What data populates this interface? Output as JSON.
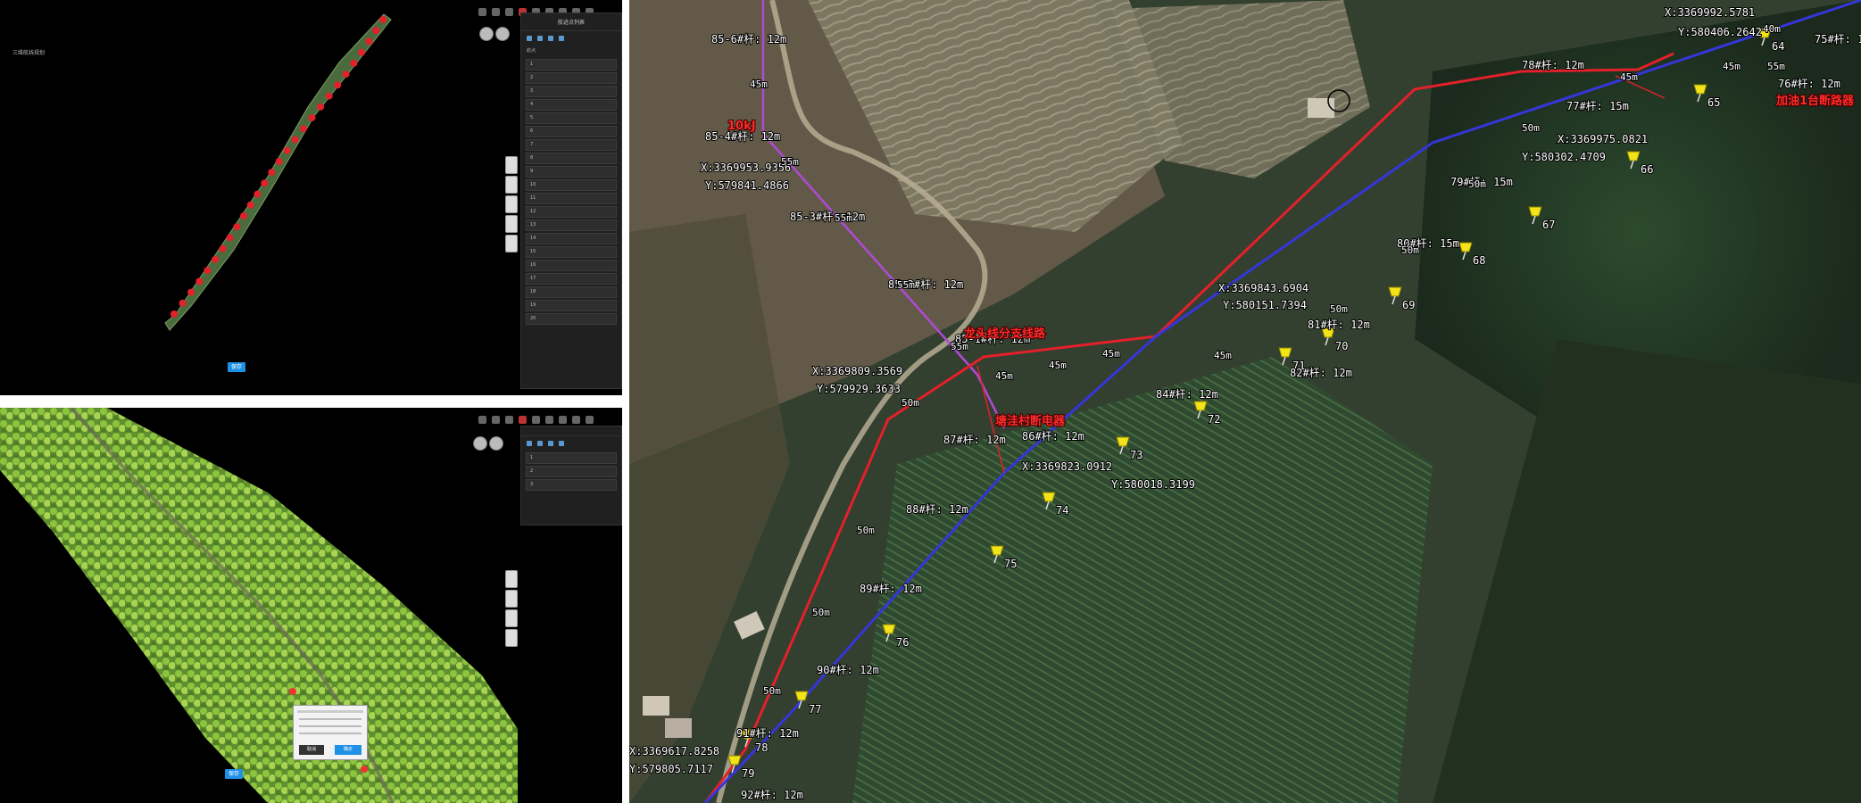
{
  "top_panel": {
    "corner_label": "三维航线规划",
    "toolbar": [
      "",
      ""
    ],
    "sidebar_title": "航迹点列表",
    "sidebar_sub_left": "航点",
    "sidebar_sub_right": "",
    "waypoints": [
      "1",
      "2",
      "3",
      "4",
      "5",
      "6",
      "7",
      "8",
      "9",
      "10",
      "11",
      "12",
      "13",
      "14",
      "15",
      "16",
      "17",
      "18",
      "19",
      "20"
    ],
    "btn_save": "保存",
    "tab_mid": "",
    "tab_right": "",
    "btn_export": ""
  },
  "bottom_panel": {
    "corner_label": "",
    "sidebar_title": "",
    "waypoints": [
      "1",
      "2",
      "3"
    ],
    "popup_btn_cancel": "取消",
    "popup_btn_ok": "确定",
    "btn_save": "保存",
    "btn_confirm": ""
  },
  "map": {
    "pole_labels": [
      "85-6#杆: 12m",
      "85-4#杆: 12m",
      "85-3#杆: 12m",
      "85-2#杆: 12m",
      "85-1#杆: 12m",
      "87#杆: 12m",
      "86#杆: 12m",
      "84#杆: 12m",
      "88#杆: 12m",
      "89#杆: 12m",
      "90#杆: 12m",
      "91#杆: 12m",
      "92#杆: 12m",
      "82#杆: 12m",
      "81#杆: 12m",
      "80#杆: 15m",
      "79#杆: 15m",
      "78#杆: 12m",
      "77#杆: 15m",
      "76#杆: 12m",
      "75#杆: 1"
    ],
    "coords": [
      "X:3369953.9356",
      "Y:579841.4866",
      "X:3369809.3569",
      "Y:579929.3633",
      "X:3369823.0912",
      "Y:580018.3199",
      "X:3369843.6904",
      "Y:580151.7394",
      "X:3369975.0821",
      "Y:580302.4709",
      "X:3369992.5781",
      "Y:580406.2642",
      "X:3369617.8258",
      "Y:579805.7117"
    ],
    "pin_numbers": [
      "64",
      "65",
      "66",
      "67",
      "68",
      "69",
      "70",
      "71",
      "72",
      "73",
      "74",
      "75",
      "76",
      "77",
      "78",
      "79"
    ],
    "span_labels": [
      "45m",
      "55m",
      "55m",
      "55m",
      "55m",
      "45m",
      "45m",
      "45m",
      "50m",
      "50m",
      "50m",
      "50m",
      "50m",
      "50m",
      "50m",
      "50m",
      "45m",
      "45m",
      "45m",
      "55m",
      "40m"
    ],
    "red_annotations": [
      "10kJ",
      "龙头线分支线路",
      "塘洼村断电器",
      "加油1台断路器"
    ],
    "colors": {
      "red_line": "#e4202a",
      "blue_line": "#3536d8",
      "purple_line": "#b04ad6",
      "pin": "#f3e41a"
    }
  }
}
